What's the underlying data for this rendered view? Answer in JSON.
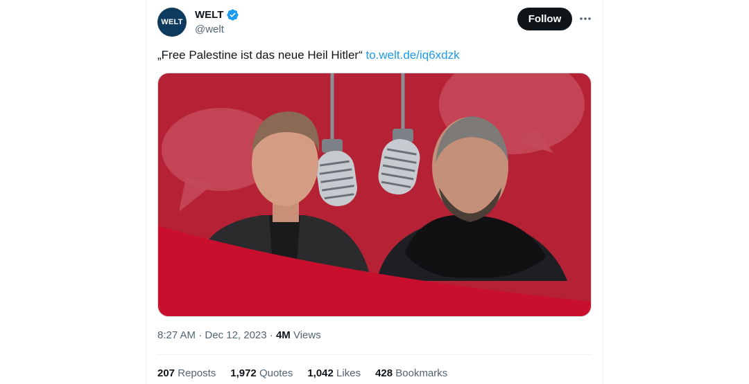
{
  "author": {
    "avatar_text": "WELT",
    "display_name": "WELT",
    "handle": "@welt",
    "verified": true
  },
  "actions": {
    "follow_label": "Follow",
    "more_label": "···"
  },
  "tweet": {
    "text": "„Free Palestine ist das neue Heil Hitler“",
    "link": "to.welt.de/iq6xdzk"
  },
  "meta": {
    "time": "8:27 AM",
    "separator_1": " · ",
    "date": "Dec 12, 2023",
    "separator_2": " · ",
    "views_count": "4M",
    "views_label": "Views"
  },
  "stats": {
    "reposts_count": "207",
    "reposts_label": "Reposts",
    "quotes_count": "1,972",
    "quotes_label": "Quotes",
    "likes_count": "1,042",
    "likes_label": "Likes",
    "bookmarks_count": "428",
    "bookmarks_label": "Bookmarks"
  },
  "colors": {
    "accent": "#1d9bf0",
    "media_background": "#b52235",
    "media_wave": "#c8102e",
    "avatar_bg": "#0f3a5f"
  }
}
